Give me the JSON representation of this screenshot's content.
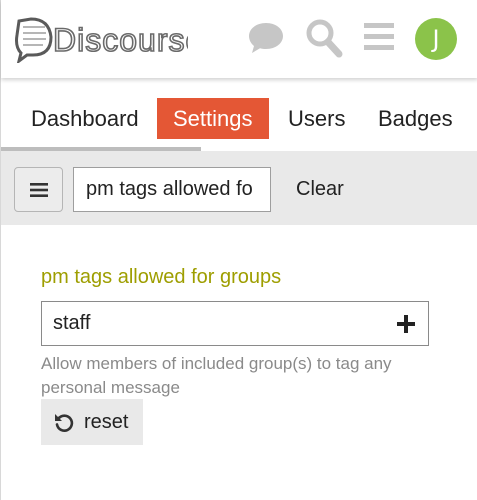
{
  "header": {
    "logo_text": "Discourse",
    "avatar_letter": "J",
    "icons": [
      "chat-icon",
      "search-icon",
      "hamburger-menu-icon"
    ],
    "avatar_color": "#8bc34a"
  },
  "tabs": [
    {
      "label": "Dashboard",
      "active": false
    },
    {
      "label": "Settings",
      "active": true
    },
    {
      "label": "Users",
      "active": false
    },
    {
      "label": "Badges",
      "active": false
    }
  ],
  "filter": {
    "value": "pm tags allowed fo",
    "clear_label": "Clear"
  },
  "setting": {
    "name": "pm tags allowed for groups",
    "tag_value": "staff",
    "description": "Allow members of included group(s) to tag any personal message",
    "reset_label": "reset"
  },
  "colors": {
    "accent": "#e45735",
    "setting_name": "#9e9e00"
  }
}
